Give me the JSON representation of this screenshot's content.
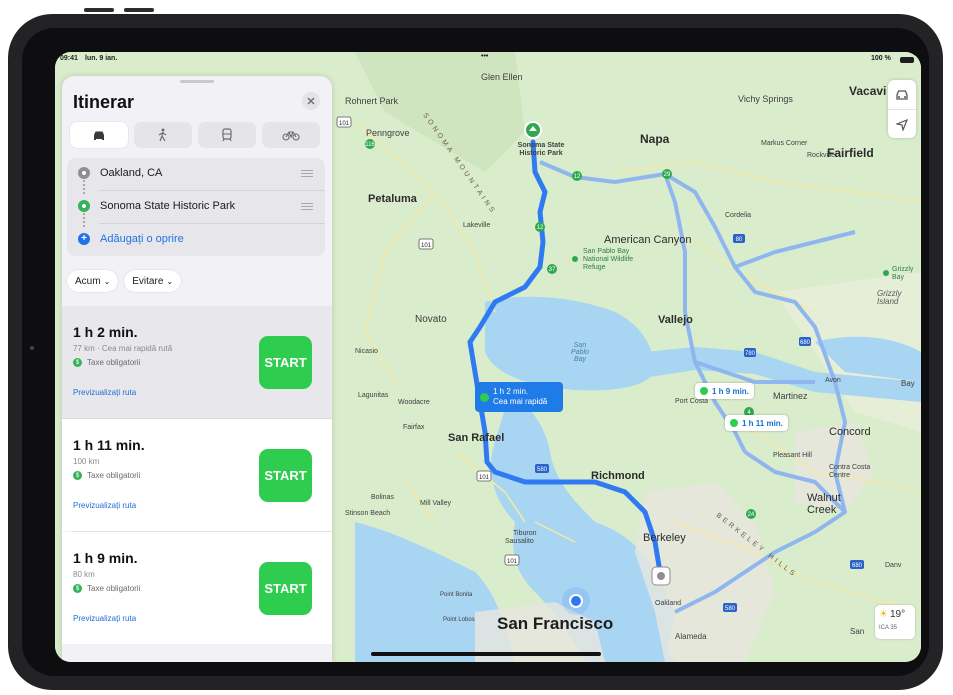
{
  "status_bar": {
    "time": "09:41",
    "date": "lun. 9 ian.",
    "dots": "•••",
    "battery": "100 %"
  },
  "panel": {
    "title": "Itinerar",
    "modes": [
      {
        "name": "car-icon",
        "active": true
      },
      {
        "name": "walk-icon",
        "active": false
      },
      {
        "name": "transit-icon",
        "active": false
      },
      {
        "name": "bike-icon",
        "active": false
      }
    ],
    "stops": [
      {
        "label": "Oakland, CA",
        "dot_color": "#8e8e93"
      },
      {
        "label": "Sonoma State Historic Park",
        "dot_color": "#34b45a"
      }
    ],
    "add_stop": "Adăugați o oprire",
    "filters": {
      "now": "Acum",
      "avoid": "Evitare"
    },
    "routes": [
      {
        "time": "1 h 2 min.",
        "sub": "77 km · Cea mai rapidă rută",
        "toll": "Taxe obligatorii",
        "preview": "Previzualizați ruta",
        "start": "START"
      },
      {
        "time": "1 h 11 min.",
        "sub": "100 km",
        "toll": "Taxe obligatorii",
        "preview": "Previzualizați ruta",
        "start": "START"
      },
      {
        "time": "1 h 9 min.",
        "sub": "80 km",
        "toll": "Taxe obligatorii",
        "preview": "Previzualizați ruta",
        "start": "START"
      }
    ]
  },
  "map": {
    "route_labels": {
      "main_time": "1 h 2 min.",
      "main_sub": "Cea mai rapidă",
      "alt1": "1 h 9 min.",
      "alt2": "1 h 11 min."
    },
    "places": {
      "glen_ellen": "Glen Ellen",
      "rohnert": "Rohnert Park",
      "vichy": "Vichy Springs",
      "vacaville": "Vacavi",
      "penngrove": "Penngrove",
      "sonoma_mtn": "SONOMA MOUNTAINS",
      "sonoma_park": "Sonoma State Historic Park",
      "napa": "Napa",
      "markus": "Markus Corner",
      "rockville": "Rockville",
      "fairfield": "Fairfield",
      "petaluma": "Petaluma",
      "lakeville": "Lakeville",
      "cordelia": "Cordelia",
      "american_canyon": "American Canyon",
      "san_pablo_refuge": "San Pablo Bay National Wildlife Refuge",
      "grizzly_bay": "Grizzly Bay",
      "grizzly_island": "Grizzly Island",
      "novato": "Novato",
      "vallejo": "Vallejo",
      "nicasio": "Nicasio",
      "san_pablo_bay": "San Pablo Bay",
      "lagunitas": "Lagunitas",
      "woodacre": "Woodacre",
      "port_costa": "Port Costa",
      "avon": "Avon",
      "bay": "Bay",
      "martinez": "Martinez",
      "fairfax": "Fairfax",
      "san_rafael": "San Rafael",
      "concord": "Concord",
      "pleasant_hill": "Pleasant Hill",
      "contra_costa": "Contra Costa Centre",
      "richmond": "Richmond",
      "bolinas": "Bolinas",
      "mill_valley": "Mill Valley",
      "stinson": "Stinson Beach",
      "walnut_creek": "Walnut Creek",
      "tiburon": "Tiburon",
      "sausalito": "Sausalito",
      "berkeley": "Berkeley",
      "berkeley_hills": "BERKELEY HILLS",
      "point_bonita": "Point Bonita",
      "point_lobos": "Point Lobos",
      "san_francisco": "San Francisco",
      "oakland": "Oakland",
      "alameda": "Alameda",
      "danville": "Danv",
      "san": "San"
    },
    "weather": {
      "temp": "19°",
      "aqi": "ICA 35"
    },
    "route_color": "#2f7af2",
    "alt_route_color": "#8fb6ef",
    "water_color": "#a8d5f2",
    "land_color": "#d9eccb"
  }
}
